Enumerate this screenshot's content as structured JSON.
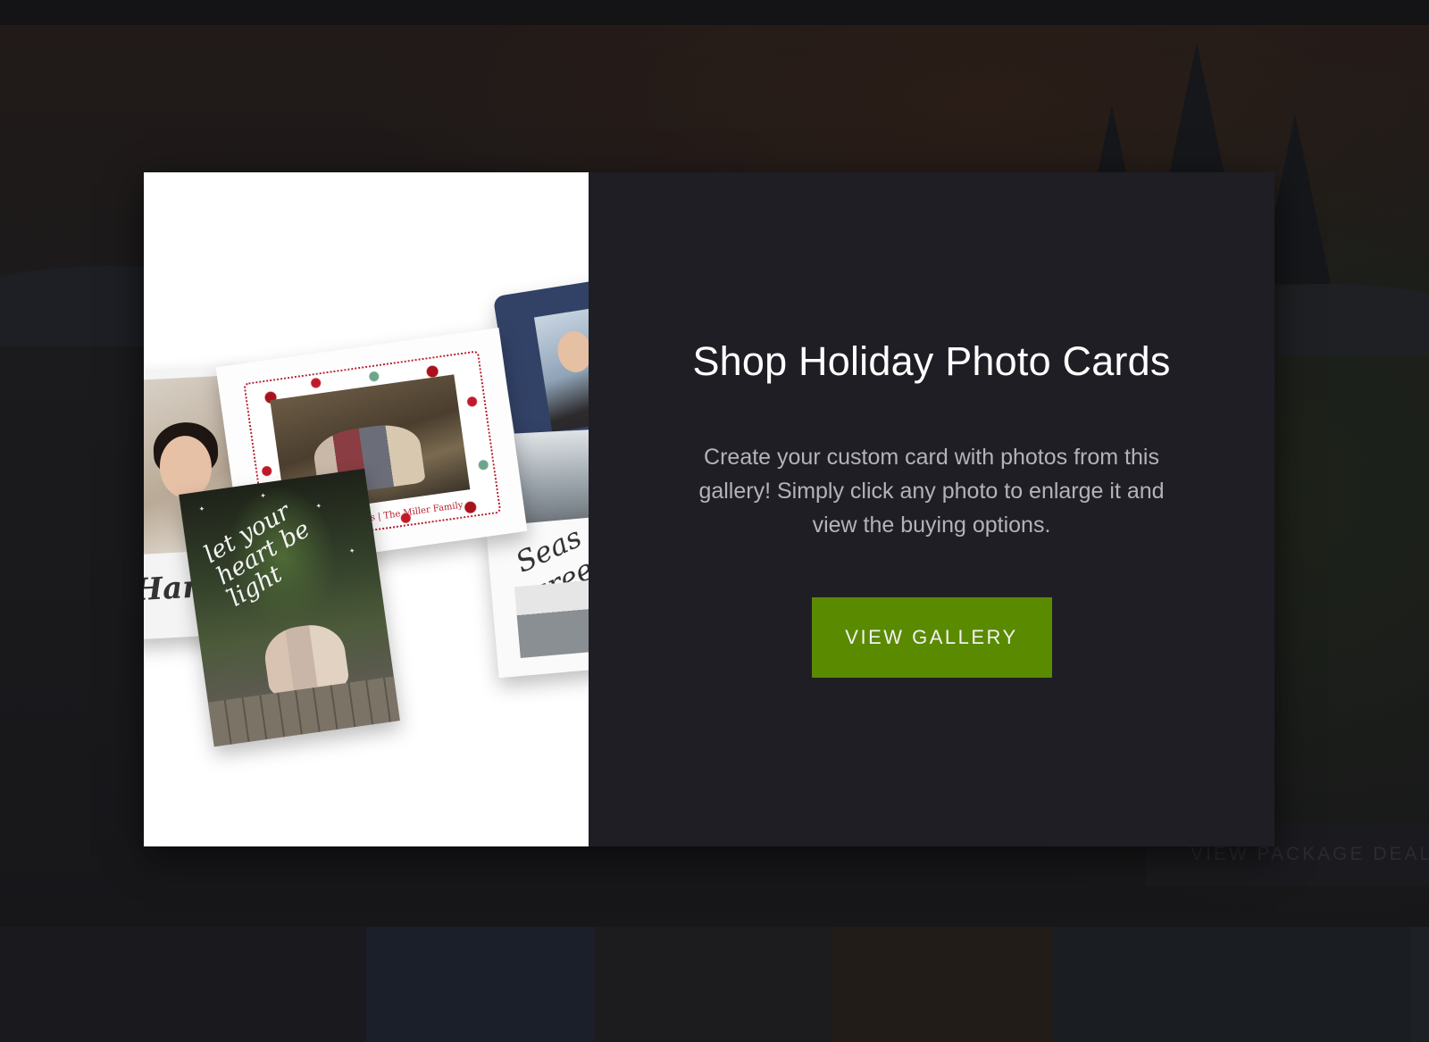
{
  "background": {
    "hero_cta_label": "VIEW PACKAGE DEALS"
  },
  "modal": {
    "image_alt": "Holiday photo card collage",
    "collage": {
      "hanukkah_card_text": "Hanuk",
      "floral_card_caption": "Happiest Holidays | The Miller Family",
      "forest_card_text": "let your heart be light",
      "season_card_text": "Seas gree"
    },
    "title": "Shop Holiday Photo Cards",
    "description": "Create your custom card with photos from this gallery! Simply click any photo to enlarge it and view the buying options.",
    "button_label": "VIEW GALLERY"
  },
  "colors": {
    "accent_button": "#5a8a00",
    "modal_panel": "#1f1e24",
    "overlay": "#17161b"
  }
}
